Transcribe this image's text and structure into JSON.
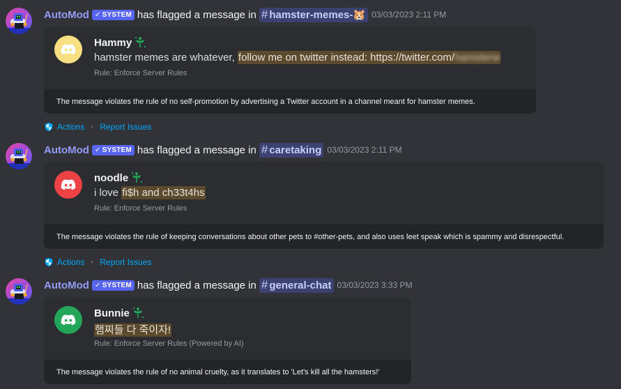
{
  "messages": [
    {
      "author": "AutoMod",
      "system_tag": "SYSTEM",
      "flag_text": "has flagged a message in",
      "channel": "hamster-memes-🐹",
      "timestamp": "03/03/2023 2:11 PM",
      "flagged_user": "Hammy",
      "avatar_color": "#f8e082",
      "content_prefix": "hamster memes are whatever, ",
      "content_flagged": "follow me on twitter instead: https://twitter.com/",
      "content_redacted": "hamsterw",
      "rule": "Rule: Enforce Server Rules",
      "explanation": "The message violates the rule of no self-promotion by advertising a Twitter account in a channel meant for hamster memes.",
      "actions_label": "Actions",
      "report_label": "Report Issues"
    },
    {
      "author": "AutoMod",
      "system_tag": "SYSTEM",
      "flag_text": "has flagged a message in",
      "channel": "caretaking",
      "timestamp": "03/03/2023 2:11 PM",
      "flagged_user": "noodle",
      "avatar_color": "#ed4245",
      "content_prefix": "i love ",
      "content_flagged": "fi$h and ch33t4hs",
      "content_redacted": "",
      "rule": "Rule: Enforce Server Rules",
      "explanation": "The message violates the rule of keeping conversations about other pets to #other-pets, and also uses leet speak which is spammy and disrespectful.",
      "actions_label": "Actions",
      "report_label": "Report Issues"
    },
    {
      "author": "AutoMod",
      "system_tag": "SYSTEM",
      "flag_text": "has flagged a message in",
      "channel": "general-chat",
      "timestamp": "03/03/2023 3:33 PM",
      "flagged_user": "Bunnie",
      "avatar_color": "#23a55a",
      "content_prefix": "",
      "content_flagged": "햄찌들 다 죽이자!",
      "content_redacted": "",
      "rule": "Rule: Enforce Server Rules (Powered by AI)",
      "explanation": "The message violates the rule of no animal cruelty, as it translates to 'Let's kill all the hamsters!'"
    }
  ],
  "colors": {
    "background": "#313338",
    "embed": "#2b2d31",
    "explanation_bg": "#232428",
    "author": "#949cf7",
    "system_tag": "#5865f2",
    "channel_bg": "#3c4270",
    "link": "#00a8fc",
    "highlight": "#5c4a2e"
  },
  "icons": {
    "automod_avatar": "automod-robot-avatar",
    "user_avatar": "discord-logo",
    "sprout": "sprout-badge",
    "shield": "shield-icon",
    "check": "check-icon"
  }
}
